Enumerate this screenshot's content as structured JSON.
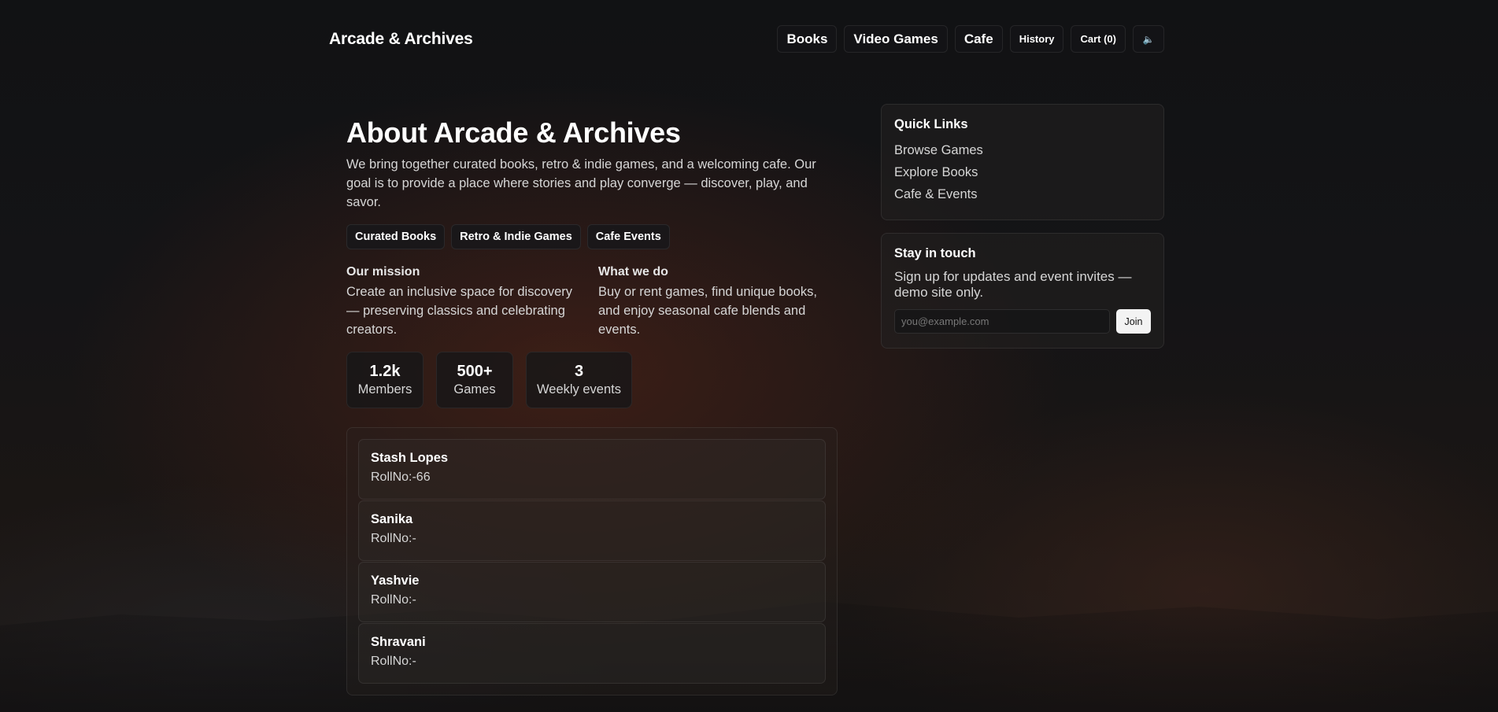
{
  "header": {
    "brand": "Arcade & Archives",
    "nav": [
      {
        "label": "Books"
      },
      {
        "label": "Video Games"
      },
      {
        "label": "Cafe"
      },
      {
        "label": "History"
      },
      {
        "label": "Cart (0)"
      },
      {
        "label": "🔈"
      }
    ]
  },
  "about": {
    "title": "About Arcade & Archives",
    "description": "We bring together curated books, retro & indie games, and a welcoming cafe. Our goal is to provide a place where stories and play converge — discover, play, and savor.",
    "tags": [
      "Curated Books",
      "Retro & Indie Games",
      "Cafe Events"
    ],
    "mission": {
      "heading": "Our mission",
      "text": "Create an inclusive space for discovery — preserving classics and celebrating creators."
    },
    "what_we_do": {
      "heading": "What we do",
      "text": "Buy or rent games, find unique books, and enjoy seasonal cafe blends and events."
    },
    "stats": [
      {
        "value": "1.2k",
        "label": "Members"
      },
      {
        "value": "500+",
        "label": "Games"
      },
      {
        "value": "3",
        "label": "Weekly events"
      }
    ],
    "members": [
      {
        "name": "Stash Lopes",
        "roll": "RollNo:-66"
      },
      {
        "name": "Sanika",
        "roll": "RollNo:-"
      },
      {
        "name": "Yashvie",
        "roll": "RollNo:-"
      },
      {
        "name": "Shravani",
        "roll": "RollNo:-"
      }
    ]
  },
  "sidebar": {
    "quick_links": {
      "title": "Quick Links",
      "items": [
        "Browse Games",
        "Explore Books",
        "Cafe & Events"
      ]
    },
    "stay_in_touch": {
      "title": "Stay in touch",
      "text": "Sign up for updates and event invites — demo site only.",
      "email_placeholder": "you@example.com",
      "join_label": "Join"
    }
  }
}
